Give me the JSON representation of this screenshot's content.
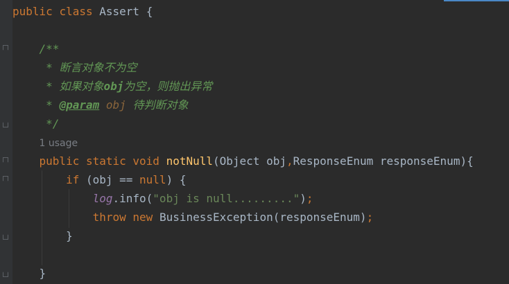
{
  "code": {
    "class_decl": {
      "kw_public": "public",
      "kw_class": "class",
      "name": "Assert",
      "brace": "{"
    },
    "doc": {
      "open": "/**",
      "line1_star": "*",
      "line1_text": "断言对象不为空",
      "line2_star": "*",
      "line2_text_a": "如果对象",
      "line2_text_b": "obj",
      "line2_text_c": "为空，则抛出异常",
      "line3_star": "*",
      "line3_tag": "@param",
      "line3_param": "obj",
      "line3_text": "待判断对象",
      "close": "*/"
    },
    "usage_hint": "1 usage",
    "method_decl": {
      "kw_public": "public",
      "kw_static": "static",
      "kw_void": "void",
      "name": "notNull",
      "params_a": "(Object obj",
      "comma": ",",
      "params_b": "ResponseEnum responseEnum){"
    },
    "if_stmt": {
      "kw_if": "if",
      "cond_a": " (obj == ",
      "kw_null": "null",
      "cond_b": ") {"
    },
    "log_stmt": {
      "field": "log",
      "call": ".info(",
      "string": "\"obj is null.........\"",
      "close": ")",
      "semi": ";"
    },
    "throw_stmt": {
      "kw_throw": "throw",
      "kw_new": "new",
      "call": " BusinessException(responseEnum)",
      "semi": ";"
    },
    "if_close": "}",
    "method_close": "}"
  },
  "colors": {
    "background": "#2b2b2b",
    "gutter": "#313335",
    "keyword": "#cc7832",
    "identifier": "#a9b7c6",
    "function": "#ffc66d",
    "string": "#6a8759",
    "doc_comment": "#629755",
    "field": "#9876aa",
    "hint": "#7a7e85",
    "accent": "#4a88c7"
  }
}
